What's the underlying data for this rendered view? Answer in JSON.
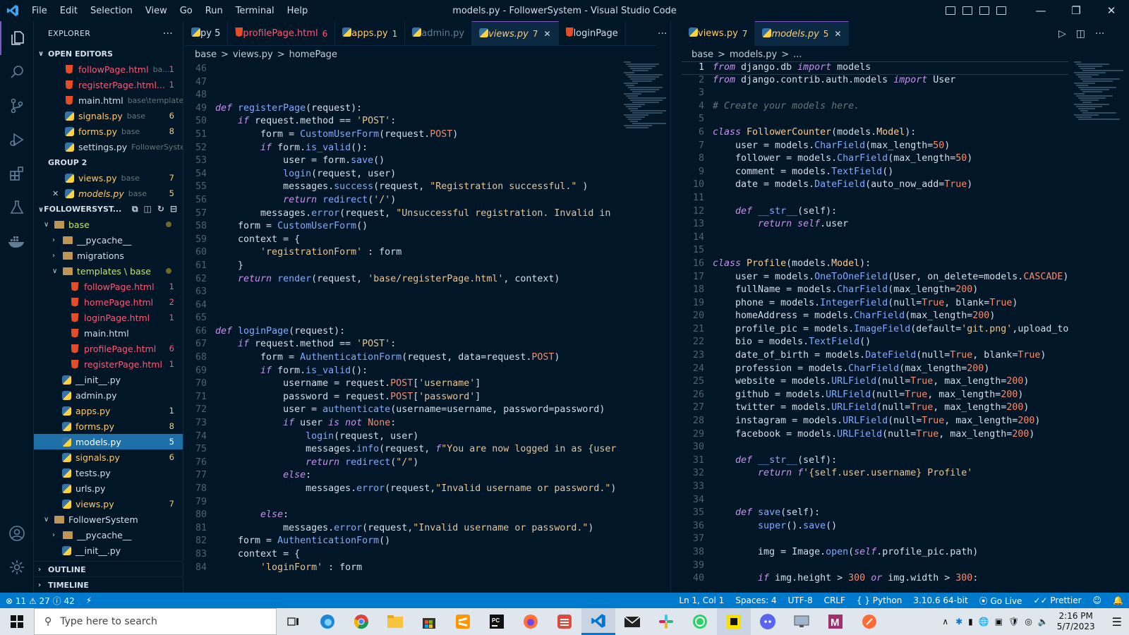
{
  "titlebar": {
    "menu": [
      "File",
      "Edit",
      "Selection",
      "View",
      "Go",
      "Run",
      "Terminal",
      "Help"
    ],
    "title": "models.py - FollowerSystem - Visual Studio Code"
  },
  "explorer": {
    "header": "EXPLORER",
    "open_editors": "OPEN EDITORS",
    "group2": "GROUP 2",
    "open_items": [
      {
        "name": "followPage.html",
        "desc": "ba...",
        "badge": "1",
        "type": "html"
      },
      {
        "name": "registerPage.html...",
        "desc": "",
        "badge": "1",
        "type": "html"
      },
      {
        "name": "main.html",
        "desc": "base\\template...",
        "badge": "",
        "type": "html"
      },
      {
        "name": "signals.py",
        "desc": "base",
        "badge": "6",
        "type": "py"
      },
      {
        "name": "forms.py",
        "desc": "base",
        "badge": "8",
        "type": "py"
      },
      {
        "name": "settings.py",
        "desc": "FollowerSystem",
        "badge": "",
        "type": "py"
      }
    ],
    "group2_items": [
      {
        "name": "views.py",
        "desc": "base",
        "badge": "7",
        "type": "py"
      },
      {
        "name": "models.py",
        "desc": "base",
        "badge": "5",
        "type": "py"
      }
    ],
    "project": "FOLLOWERSYST...",
    "tree": {
      "base": "base",
      "pycache": "__pycache__",
      "migrations": "migrations",
      "templates": "templates \\ base",
      "template_files": [
        {
          "name": "followPage.html",
          "badge": "1"
        },
        {
          "name": "homePage.html",
          "badge": "2"
        },
        {
          "name": "loginPage.html",
          "badge": "1"
        },
        {
          "name": "main.html",
          "badge": ""
        },
        {
          "name": "profilePage.html",
          "badge": "6"
        },
        {
          "name": "registerPage.html",
          "badge": "1"
        }
      ],
      "py_files": [
        {
          "name": "__init__.py",
          "badge": ""
        },
        {
          "name": "admin.py",
          "badge": ""
        },
        {
          "name": "apps.py",
          "badge": "1"
        },
        {
          "name": "forms.py",
          "badge": "8"
        },
        {
          "name": "models.py",
          "badge": "5"
        },
        {
          "name": "signals.py",
          "badge": "6"
        },
        {
          "name": "tests.py",
          "badge": ""
        },
        {
          "name": "urls.py",
          "badge": ""
        },
        {
          "name": "views.py",
          "badge": "7"
        }
      ],
      "followersystem": "FollowerSystem",
      "fs_pycache": "__pycache__",
      "fs_init": "__init__.py"
    },
    "outline": "OUTLINE",
    "timeline": "TIMELINE"
  },
  "left_tabs": [
    {
      "name": "py 5",
      "badge": "",
      "type": "py",
      "dim": false
    },
    {
      "name": "profilePage.html",
      "badge": "6",
      "type": "html",
      "dim": false
    },
    {
      "name": "apps.py",
      "badge": "1",
      "type": "py",
      "dim": false
    },
    {
      "name": "admin.py",
      "badge": "",
      "type": "py",
      "dim": true
    },
    {
      "name": "views.py",
      "badge": "7",
      "type": "py",
      "dim": false,
      "active": true
    },
    {
      "name": "loginPage",
      "badge": "",
      "type": "html",
      "dim": false
    }
  ],
  "right_tabs": [
    {
      "name": "views.py",
      "badge": "7",
      "type": "py"
    },
    {
      "name": "models.py",
      "badge": "5",
      "type": "py",
      "active": true
    }
  ],
  "left_crumb": [
    "base",
    ">",
    "views.py",
    ">",
    "homePage"
  ],
  "right_crumb": [
    "base",
    ">",
    "models.py",
    ">",
    "..."
  ],
  "left_start_line": 46,
  "right_start_line": 1,
  "status": {
    "errors": "11",
    "warnings": "27",
    "info": "42",
    "position": "Ln 1, Col 1",
    "spaces": "Spaces: 4",
    "encoding": "UTF-8",
    "eol": "CRLF",
    "language": "Python",
    "interpreter": "3.10.6 64-bit",
    "golive": "Go Live",
    "prettier": "Prettier"
  },
  "taskbar": {
    "search_placeholder": "Type here to search",
    "time": "2:16 PM",
    "date": "5/7/2023"
  }
}
